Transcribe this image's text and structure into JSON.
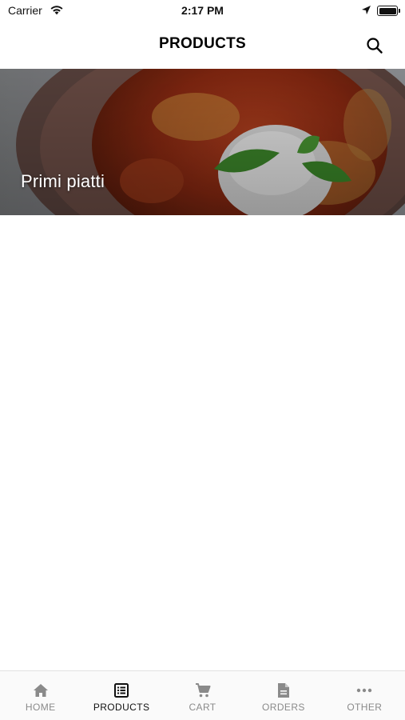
{
  "status_bar": {
    "carrier": "Carrier",
    "time": "2:17 PM"
  },
  "navbar": {
    "title": "PRODUCTS",
    "search_icon": "search-icon"
  },
  "categories": [
    {
      "label": "Primi piatti",
      "image": "pasta-with-tomato-sauce-ricotta-and-basil"
    }
  ],
  "tabbar": {
    "active_color": "#111111",
    "inactive_color": "#8a8a8a",
    "tabs": [
      {
        "label": "HOME",
        "icon": "home-icon",
        "active": false
      },
      {
        "label": "PRODUCTS",
        "icon": "list-icon",
        "active": true
      },
      {
        "label": "CART",
        "icon": "cart-icon",
        "active": false
      },
      {
        "label": "ORDERS",
        "icon": "document-icon",
        "active": false
      },
      {
        "label": "OTHER",
        "icon": "more-icon",
        "active": false
      }
    ]
  }
}
